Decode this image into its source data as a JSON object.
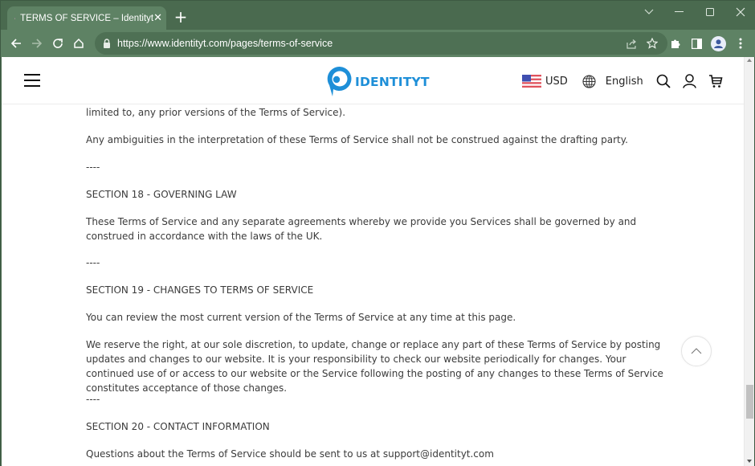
{
  "browser": {
    "tab": {
      "title": "TERMS OF SERVICE – Identityt",
      "favicon": "us-flag-icon"
    },
    "new_tab_label": "+",
    "window_controls": [
      "tab-search",
      "minimize",
      "maximize",
      "close"
    ],
    "url": "https://www.identityt.com/pages/terms-of-service",
    "toolbar_icons": [
      "back",
      "forward",
      "reload",
      "home",
      "lock",
      "share",
      "bookmark-star",
      "extensions",
      "side-panel",
      "profile",
      "menu"
    ]
  },
  "site": {
    "logo_text": "IDENTITYT",
    "brand_color": "#1e8fd8",
    "currency": "USD",
    "language": "English",
    "header_icons": [
      "menu",
      "globe",
      "search",
      "account",
      "cart"
    ]
  },
  "content": {
    "paragraphs": [
      {
        "text": "limited to, any prior versions of the Terms of Service).",
        "type": "text"
      },
      {
        "text": "Any ambiguities in the interpretation of these Terms of Service shall not be construed against the drafting party.",
        "type": "text"
      },
      {
        "text": "----",
        "type": "separator"
      },
      {
        "text": "SECTION 18 - GOVERNING LAW",
        "type": "heading"
      },
      {
        "text": "These Terms of Service and any separate agreements whereby we provide you Services shall be governed by and construed in accordance with the laws of the UK.",
        "type": "text"
      },
      {
        "text": "----",
        "type": "separator"
      },
      {
        "text": "SECTION 19 - CHANGES TO TERMS OF SERVICE",
        "type": "heading"
      },
      {
        "text": "You can review the most current version of the Terms of Service at any time at this page.",
        "type": "text"
      },
      {
        "text": "We reserve the right, at our sole discretion, to update, change or replace any part of these Terms of Service by posting updates and changes to our website. It is your responsibility to check our website periodically for changes. Your continued use of or access to our website or the Service following the posting of any changes to these Terms of Service constitutes acceptance of those changes.",
        "type": "text"
      },
      {
        "text": "----",
        "type": "separator"
      },
      {
        "text": "SECTION 20 - CONTACT INFORMATION",
        "type": "heading"
      },
      {
        "text": "Questions about the Terms of Service should be sent to us at support@identityt.com",
        "type": "text"
      }
    ]
  },
  "scroll_to_top": "scroll-to-top",
  "scroll_position_fraction": 0.82
}
